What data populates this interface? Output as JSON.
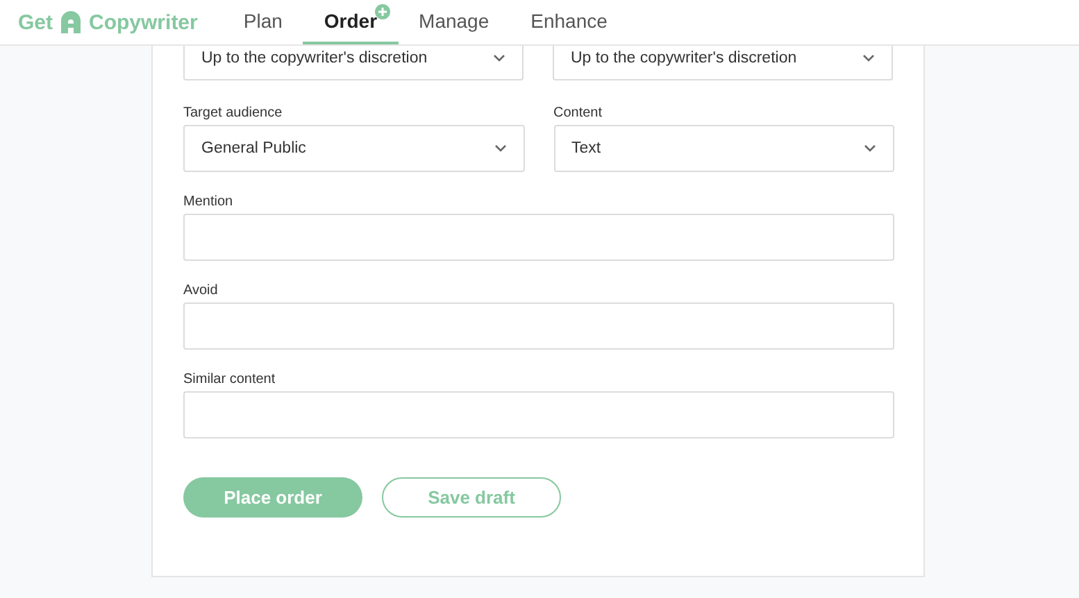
{
  "brand": {
    "first": "Get",
    "second": "Copywriter"
  },
  "nav": [
    {
      "label": "Plan",
      "selected": false,
      "badge": false
    },
    {
      "label": "Order",
      "selected": true,
      "badge": true
    },
    {
      "label": "Manage",
      "selected": false,
      "badge": false
    },
    {
      "label": "Enhance",
      "selected": false,
      "badge": false
    }
  ],
  "top_selects": [
    {
      "value": "Up to the copywriter's discretion"
    },
    {
      "value": "Up to the copywriter's discretion"
    }
  ],
  "selects": [
    {
      "label": "Target audience",
      "value": "General Public"
    },
    {
      "label": "Content",
      "value": "Text"
    }
  ],
  "fields": [
    {
      "label": "Mention"
    },
    {
      "label": "Avoid"
    },
    {
      "label": "Similar content"
    }
  ],
  "buttons": [
    {
      "label": "Place order",
      "kind": "primary"
    },
    {
      "label": "Save draft",
      "kind": "secondary"
    }
  ]
}
